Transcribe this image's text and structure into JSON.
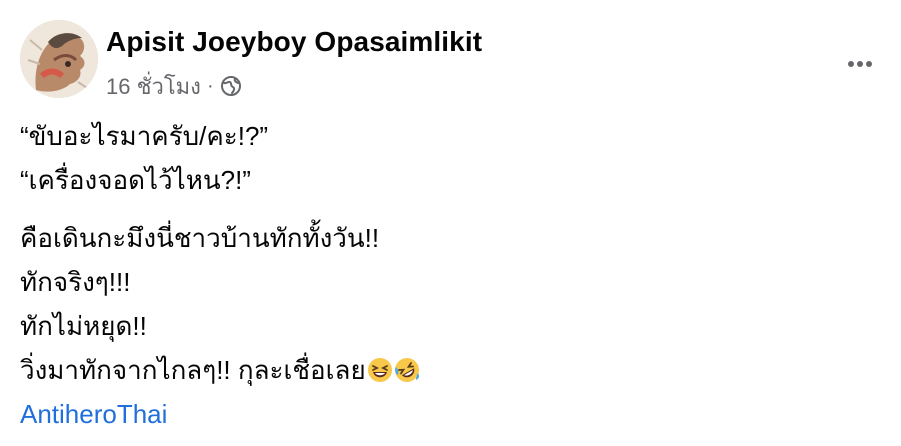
{
  "author": {
    "name": "Apisit Joeyboy Opasaimlikit"
  },
  "meta": {
    "time": "16 ชั่วโมง",
    "separator": "·",
    "audience_icon": "globe-icon"
  },
  "more_button_icon": "more-horizontal-icon",
  "post": {
    "paragraph1": [
      "“ขับอะไรมาครับ/คะ!?”",
      "“เครื่องจอดไว้ไหน?!”"
    ],
    "paragraph2": [
      "คือเดินกะมึงนี่ชาวบ้านทักทั้งวัน!!",
      "ทักจริงๆ!!!",
      "ทักไม่หยุด!!",
      "วิ่งมาทักจากไกลๆ!! กุละเชื่อเลย"
    ],
    "emojis": [
      "grinning-squinting-face-icon",
      "rolling-on-floor-laughing-icon"
    ],
    "hashtag": "AntiheroThai"
  },
  "colors": {
    "text": "#050505",
    "secondary": "#65676b",
    "link": "#216fdb"
  }
}
